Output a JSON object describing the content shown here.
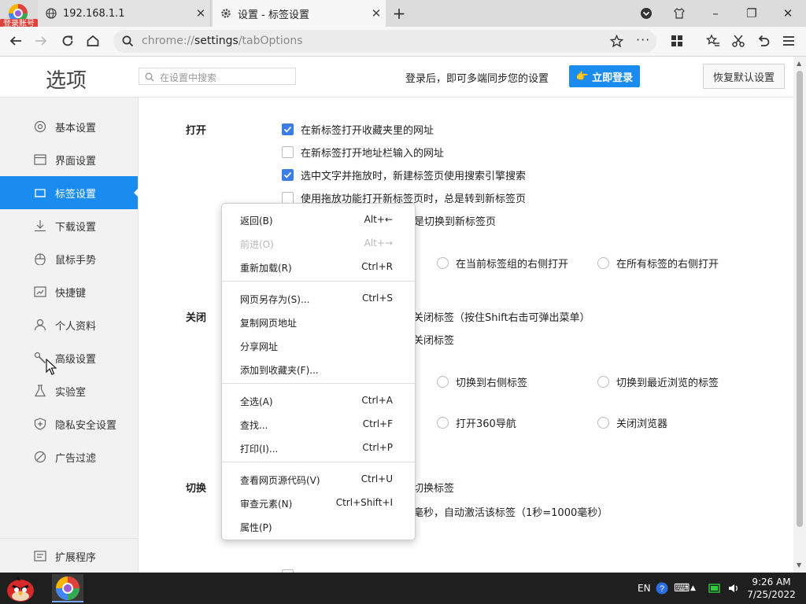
{
  "browser": {
    "account_badge": "登录账号",
    "tabs": [
      {
        "title": "192.168.1.1"
      },
      {
        "title": "设置 - 标签设置"
      }
    ],
    "new_tab_label": "+",
    "window": {
      "minimize": "–",
      "restore": "❐",
      "close": "✕"
    },
    "address": {
      "scheme": "chrome://",
      "host": "settings",
      "path": "/tabOptions"
    }
  },
  "header": {
    "title": "选项",
    "search_placeholder": "在设置中搜索",
    "sync_text": "登录后，即可多端同步您的设置",
    "login_button": "立即登录",
    "reset_button": "恢复默认设置"
  },
  "sidebar": {
    "items": [
      {
        "label": "基本设置",
        "icon": "circle-settings-icon"
      },
      {
        "label": "界面设置",
        "icon": "window-icon"
      },
      {
        "label": "标签设置",
        "icon": "tab-icon",
        "active": true
      },
      {
        "label": "下载设置",
        "icon": "download-icon"
      },
      {
        "label": "鼠标手势",
        "icon": "mouse-icon"
      },
      {
        "label": "快捷键",
        "icon": "keyboard-icon"
      },
      {
        "label": "个人资料",
        "icon": "person-icon"
      },
      {
        "label": "高级设置",
        "icon": "wrench-icon"
      },
      {
        "label": "实验室",
        "icon": "flask-icon"
      },
      {
        "label": "隐私安全设置",
        "icon": "shield-icon"
      },
      {
        "label": "广告过滤",
        "icon": "block-icon"
      }
    ],
    "extensions": "扩展程序"
  },
  "content": {
    "sections": {
      "open": "打开",
      "close": "关闭",
      "switch": "切换"
    },
    "open_options": [
      {
        "label": "在新标签打开收藏夹里的网址",
        "checked": true
      },
      {
        "label": "在新标签打开地址栏输入的网址",
        "checked": false
      },
      {
        "label": "选中文字并拖放时，新建标签页使用搜索引擎搜索",
        "checked": true
      },
      {
        "label": "使用拖放功能打开新标签页时，总是转到新标签页",
        "checked": false
      }
    ],
    "open_option_5_tail": "总是切换到新标签页",
    "position_radios": [
      "在当前标签组的右侧打开",
      "在所有标签的右侧打开"
    ],
    "close_option_1_tail": "关闭标签（按住Shift右击可弹出菜单）",
    "close_option_2_tail": "关闭标签",
    "after_close_radios": [
      "切换到右侧标签",
      "切换到最近浏览的标签"
    ],
    "last_tab_radios": [
      "打开360导航",
      "关闭浏览器"
    ],
    "switch_option_1_tail": "切换标签",
    "switch_option_2_tail": "毫秒，自动激活该标签（1秒=1000毫秒）"
  },
  "context_menu": {
    "groups": [
      [
        {
          "label": "返回(B)",
          "shortcut": "Alt+←",
          "disabled": false
        },
        {
          "label": "前进(O)",
          "shortcut": "Alt+→",
          "disabled": true
        },
        {
          "label": "重新加载(R)",
          "shortcut": "Ctrl+R",
          "disabled": false
        }
      ],
      [
        {
          "label": "网页另存为(S)...",
          "shortcut": "Ctrl+S",
          "disabled": false
        },
        {
          "label": "复制网页地址",
          "shortcut": "",
          "disabled": false
        },
        {
          "label": "分享网址",
          "shortcut": "",
          "disabled": false
        },
        {
          "label": "添加到收藏夹(F)...",
          "shortcut": "",
          "disabled": false
        }
      ],
      [
        {
          "label": "全选(A)",
          "shortcut": "Ctrl+A",
          "disabled": false
        },
        {
          "label": "查找...",
          "shortcut": "Ctrl+F",
          "disabled": false
        },
        {
          "label": "打印(I)...",
          "shortcut": "Ctrl+P",
          "disabled": false
        }
      ],
      [
        {
          "label": "查看网页源代码(V)",
          "shortcut": "Ctrl+U",
          "disabled": false
        },
        {
          "label": "审查元素(N)",
          "shortcut": "Ctrl+Shift+I",
          "disabled": false
        },
        {
          "label": "属性(P)",
          "shortcut": "",
          "disabled": false
        }
      ]
    ]
  },
  "taskbar": {
    "language": "EN",
    "time": "9:26 AM",
    "date": "7/25/2022"
  },
  "colors": {
    "accent": "#1a8cf0",
    "checkbox": "#3b7de4",
    "badge": "#e0413a"
  }
}
